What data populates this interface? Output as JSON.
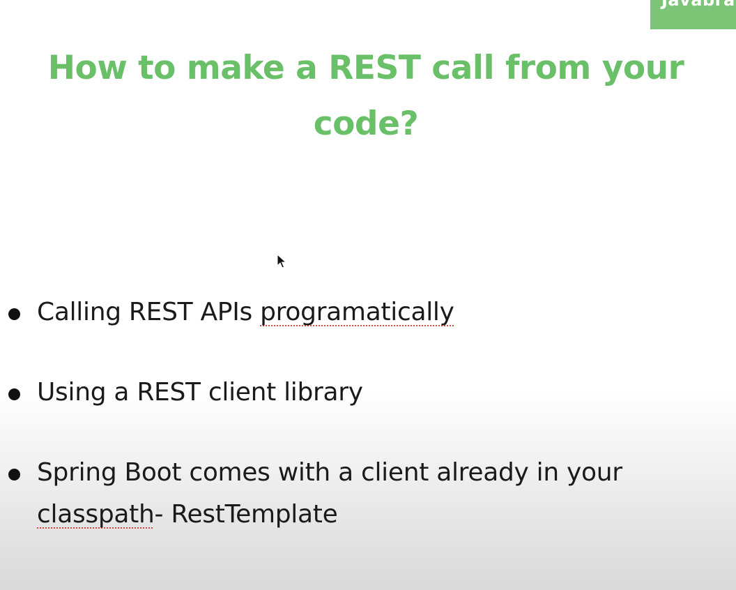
{
  "brand": {
    "label": "Javabra",
    "color": "#7cc576"
  },
  "slide": {
    "title": "How to make a REST call from your code?",
    "title_color": "#6abf69",
    "bullets": [
      {
        "text_before": "Calling REST APIs ",
        "marked_word": "programatically",
        "text_after": ""
      },
      {
        "text_before": "Using a REST client library",
        "marked_word": "",
        "text_after": ""
      },
      {
        "text_before": "Spring Boot comes with a client already in your ",
        "marked_word": "classpath",
        "text_after": "- RestTemplate"
      }
    ]
  },
  "icons": {
    "cursor": "mouse-pointer-icon",
    "bullet": "bullet-dot-icon"
  }
}
